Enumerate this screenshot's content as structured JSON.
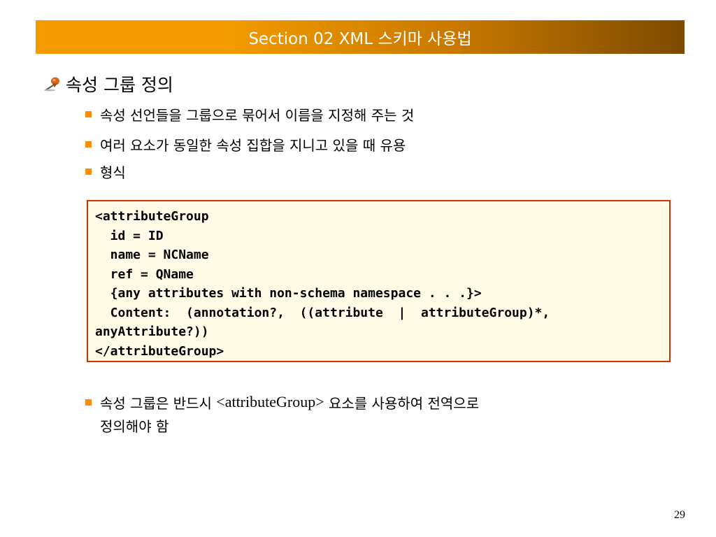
{
  "slide": {
    "title": "Section 02 XML 스키마 사용법",
    "heading": "속성 그룹 정의",
    "bullets": [
      "속성 선언들을 그룹으로 묶어서 이름을 지정해 주는 것",
      "여러 요소가 동일한 속성 집합을 지니고 있을 때 유용",
      "형식"
    ],
    "code_lines": [
      "<attributeGroup",
      "  id = ID",
      "  name = NCName",
      "  ref = QName",
      "  {any attributes with non-schema namespace . . .}>",
      "  Content:  (annotation?,  ((attribute  |  attributeGroup)*,",
      "anyAttribute?))",
      "</attributeGroup>"
    ],
    "last_bullet": {
      "part1": "속성 그룹은 반드시 ",
      "part2": "<attributeGroup>",
      "part3": " 요소를 사용하여 전역으로",
      "line2": "정의해야 함"
    },
    "page_number": "29",
    "colors": {
      "title_bar_start": "#f29a00",
      "title_bar_end": "#7d4a00",
      "bullet": "#ff8c00",
      "code_border": "#cc3300",
      "code_background": "#fffbe6"
    },
    "icons": {
      "heading_icon": "pushpin-icon",
      "bullet_icon": "square-bullet-icon"
    }
  }
}
